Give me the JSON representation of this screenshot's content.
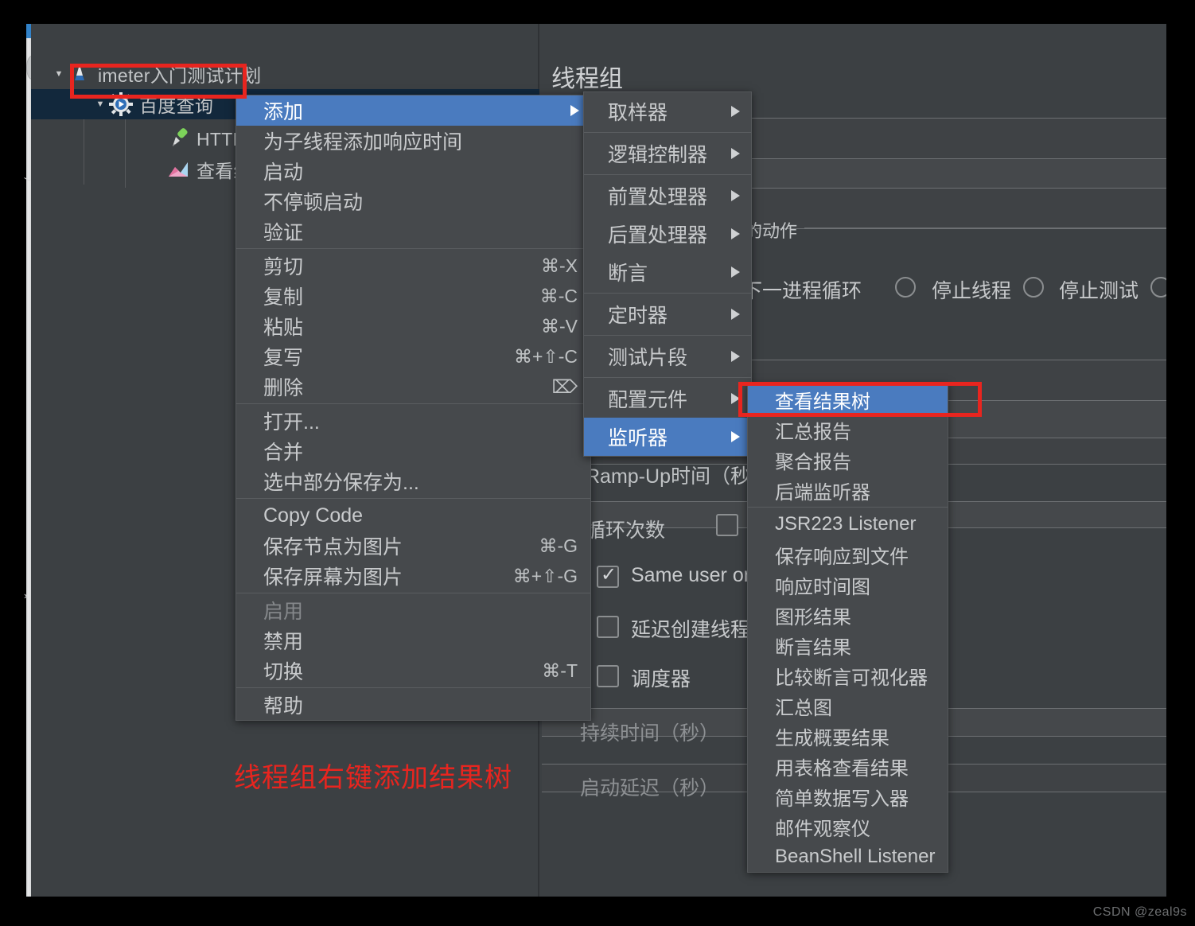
{
  "window": {
    "content_title": "线程组"
  },
  "tree": {
    "items": [
      {
        "label": "imeter入门测试计划",
        "icon": "jmeter-testplan-icon",
        "indent": 0,
        "twisty": "▼",
        "selected": false
      },
      {
        "label": "百度查询",
        "icon": "thread-group-gear-icon",
        "indent": 1,
        "twisty": "▼",
        "selected": true
      },
      {
        "label": "HTTP请",
        "icon": "http-request-icon",
        "indent": 2,
        "twisty": "",
        "selected": false
      },
      {
        "label": "查看结果",
        "icon": "view-results-tree-icon",
        "indent": 2,
        "twisty": "",
        "selected": false
      }
    ]
  },
  "form": {
    "action_group_label": "的动作",
    "radios": [
      {
        "label": "下一进程循环",
        "checked": false
      },
      {
        "label": "停止线程",
        "checked": false
      },
      {
        "label": "停止测试",
        "checked": false
      }
    ],
    "fields": [
      {
        "label": "Ramp-Up时间（秒",
        "dim": false
      },
      {
        "label": "循环次数",
        "dim": false
      },
      {
        "label": "持续时间（秒）",
        "dim": true
      },
      {
        "label": "启动延迟（秒）",
        "dim": true
      }
    ],
    "checkboxes": [
      {
        "label": "Same user on",
        "checked": true
      },
      {
        "label": "延迟创建线程î",
        "checked": false
      },
      {
        "label": "调度器",
        "checked": false
      }
    ]
  },
  "menu_main": {
    "items": [
      {
        "label": "添加",
        "accel": "",
        "submenu": true,
        "highlight": true,
        "disabled": false
      },
      {
        "separator": false,
        "label": "为子线程添加响应时间",
        "accel": "",
        "submenu": false,
        "highlight": false,
        "disabled": false
      },
      {
        "label": "启动",
        "accel": "",
        "submenu": false,
        "highlight": false,
        "disabled": false
      },
      {
        "label": "不停顿启动",
        "accel": "",
        "submenu": false,
        "highlight": false,
        "disabled": false
      },
      {
        "label": "验证",
        "accel": "",
        "submenu": false,
        "highlight": false,
        "disabled": false
      },
      {
        "separator": true
      },
      {
        "label": "剪切",
        "accel": "⌘-X",
        "submenu": false,
        "highlight": false,
        "disabled": false
      },
      {
        "label": "复制",
        "accel": "⌘-C",
        "submenu": false,
        "highlight": false,
        "disabled": false
      },
      {
        "label": "粘贴",
        "accel": "⌘-V",
        "submenu": false,
        "highlight": false,
        "disabled": false
      },
      {
        "label": "复写",
        "accel": "⌘+⇧-C",
        "submenu": false,
        "highlight": false,
        "disabled": false
      },
      {
        "label": "删除",
        "accel": "⌦",
        "submenu": false,
        "highlight": false,
        "disabled": false
      },
      {
        "separator": true
      },
      {
        "label": "打开...",
        "accel": "",
        "submenu": false,
        "highlight": false,
        "disabled": false
      },
      {
        "label": "合并",
        "accel": "",
        "submenu": false,
        "highlight": false,
        "disabled": false
      },
      {
        "label": "选中部分保存为...",
        "accel": "",
        "submenu": false,
        "highlight": false,
        "disabled": false
      },
      {
        "separator": true
      },
      {
        "label": "Copy Code",
        "accel": "",
        "submenu": false,
        "highlight": false,
        "disabled": false
      },
      {
        "label": "保存节点为图片",
        "accel": "⌘-G",
        "submenu": false,
        "highlight": false,
        "disabled": false
      },
      {
        "label": "保存屏幕为图片",
        "accel": "⌘+⇧-G",
        "submenu": false,
        "highlight": false,
        "disabled": false
      },
      {
        "separator": true
      },
      {
        "label": "启用",
        "accel": "",
        "submenu": false,
        "highlight": false,
        "disabled": true
      },
      {
        "label": "禁用",
        "accel": "",
        "submenu": false,
        "highlight": false,
        "disabled": false
      },
      {
        "label": "切换",
        "accel": "⌘-T",
        "submenu": false,
        "highlight": false,
        "disabled": false
      },
      {
        "separator": true
      },
      {
        "label": "帮助",
        "accel": "",
        "submenu": false,
        "highlight": false,
        "disabled": false
      }
    ]
  },
  "menu_add": {
    "items": [
      {
        "label": "取样器",
        "submenu": true,
        "highlight": false
      },
      {
        "separator": true
      },
      {
        "label": "逻辑控制器",
        "submenu": true,
        "highlight": false
      },
      {
        "separator": true
      },
      {
        "label": "前置处理器",
        "submenu": true,
        "highlight": false
      },
      {
        "label": "后置处理器",
        "submenu": true,
        "highlight": false
      },
      {
        "label": "断言",
        "submenu": true,
        "highlight": false
      },
      {
        "separator": true
      },
      {
        "label": "定时器",
        "submenu": true,
        "highlight": false
      },
      {
        "separator": true
      },
      {
        "label": "测试片段",
        "submenu": true,
        "highlight": false
      },
      {
        "separator": true
      },
      {
        "label": "配置元件",
        "submenu": true,
        "highlight": false
      },
      {
        "label": "监听器",
        "submenu": true,
        "highlight": true
      }
    ]
  },
  "menu_listener": {
    "items": [
      {
        "label": "查看结果树",
        "highlight": true
      },
      {
        "label": "汇总报告",
        "highlight": false
      },
      {
        "label": "聚合报告",
        "highlight": false
      },
      {
        "label": "后端监听器",
        "highlight": false
      },
      {
        "separator": true
      },
      {
        "label": "JSR223 Listener",
        "highlight": false
      },
      {
        "label": "保存响应到文件",
        "highlight": false
      },
      {
        "label": "响应时间图",
        "highlight": false
      },
      {
        "label": "图形结果",
        "highlight": false
      },
      {
        "label": "断言结果",
        "highlight": false
      },
      {
        "label": "比较断言可视化器",
        "highlight": false
      },
      {
        "label": "汇总图",
        "highlight": false
      },
      {
        "label": "生成概要结果",
        "highlight": false
      },
      {
        "label": "用表格查看结果",
        "highlight": false
      },
      {
        "label": "简单数据写入器",
        "highlight": false
      },
      {
        "label": "邮件观察仪",
        "highlight": false
      },
      {
        "label": "BeanShell Listener",
        "highlight": false
      }
    ]
  },
  "annotations": {
    "note_text": "线程组右键添加结果树",
    "highlight_color": "#e8251f"
  },
  "watermark": {
    "text": "CSDN @zeal9s"
  }
}
